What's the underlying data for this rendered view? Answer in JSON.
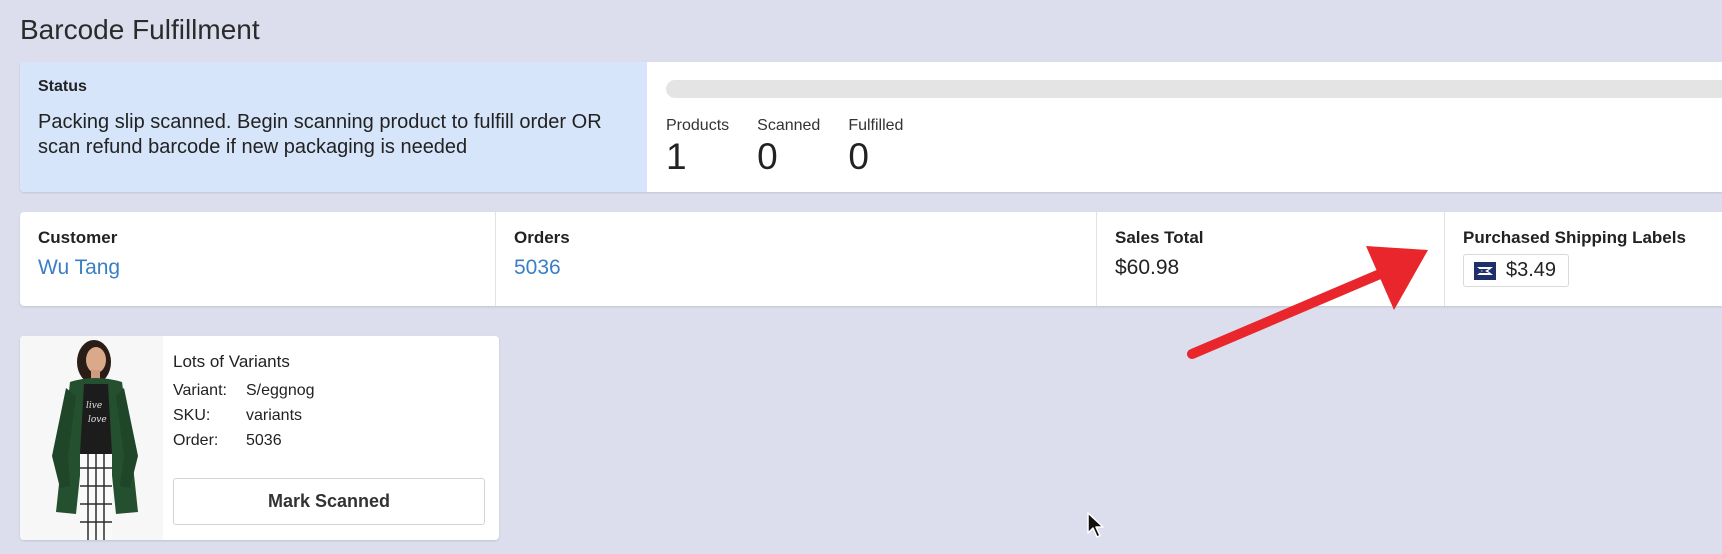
{
  "page": {
    "title": "Barcode Fulfillment"
  },
  "status": {
    "heading": "Status",
    "message": "Packing slip scanned. Begin scanning product to fulfill order OR scan refund barcode if new packaging is needed",
    "progress_fraction": 0,
    "counters": [
      {
        "label": "Products",
        "value": "1"
      },
      {
        "label": "Scanned",
        "value": "0"
      },
      {
        "label": "Fulfilled",
        "value": "0"
      }
    ]
  },
  "info": {
    "customer": {
      "label": "Customer",
      "value": "Wu Tang"
    },
    "orders": {
      "label": "Orders",
      "value": "5036"
    },
    "sales_total": {
      "label": "Sales Total",
      "value": "$60.98"
    },
    "shipping_labels": {
      "label": "Purchased Shipping Labels",
      "carrier_icon": "usps-eagle-icon",
      "value": "$3.49"
    }
  },
  "product": {
    "name": "Lots of Variants",
    "details": [
      {
        "key": "Variant:",
        "value": "S/eggnog"
      },
      {
        "key": "SKU:",
        "value": "variants"
      },
      {
        "key": "Order:",
        "value": "5036"
      }
    ],
    "button_label": "Mark Scanned"
  },
  "colors": {
    "background": "#dcdeed",
    "status_panel": "#d6e5fa",
    "link": "#3a7fc4",
    "annotation_arrow": "#e8262b"
  }
}
